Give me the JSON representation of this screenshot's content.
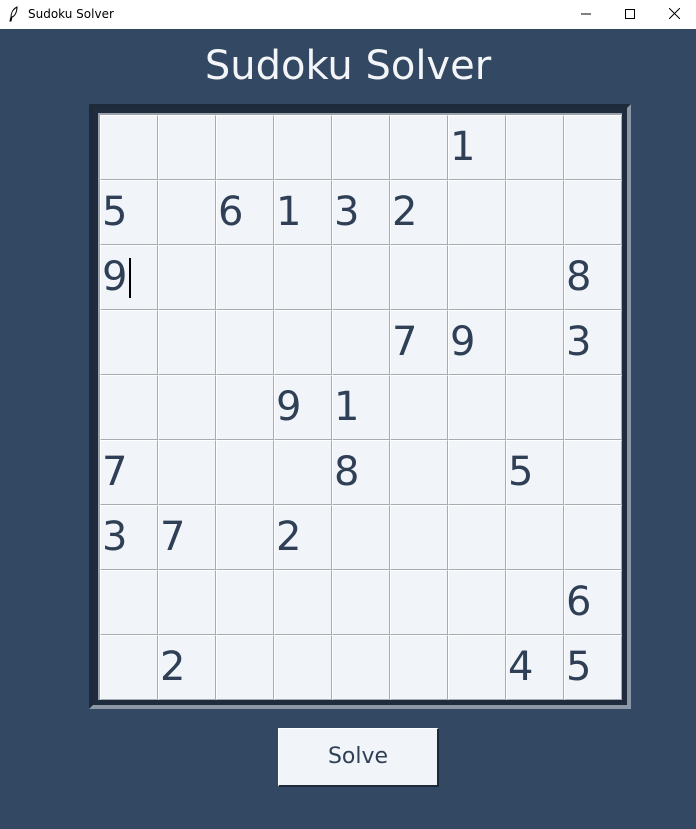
{
  "window": {
    "title": "Sudoku Solver",
    "icon": "feather-icon",
    "controls": [
      "minimize-icon",
      "maximize-icon",
      "close-icon"
    ]
  },
  "heading": "Sudoku Solver",
  "grid": [
    [
      "",
      "",
      "",
      "",
      "",
      "",
      "1",
      "",
      ""
    ],
    [
      "5",
      "",
      "6",
      "1",
      "3",
      "2",
      "",
      "",
      ""
    ],
    [
      "9",
      "",
      "",
      "",
      "",
      "",
      "",
      "",
      "8"
    ],
    [
      "",
      "",
      "",
      "",
      "",
      "7",
      "9",
      "",
      "3"
    ],
    [
      "",
      "",
      "",
      "9",
      "1",
      "",
      "",
      "",
      ""
    ],
    [
      "7",
      "",
      "",
      "",
      "8",
      "",
      "",
      "5",
      ""
    ],
    [
      "3",
      "7",
      "",
      "2",
      "",
      "",
      "",
      "",
      ""
    ],
    [
      "",
      "",
      "",
      "",
      "",
      "",
      "",
      "",
      "6"
    ],
    [
      "",
      "2",
      "",
      "",
      "",
      "",
      "",
      "4",
      "5"
    ]
  ],
  "focused_cell": {
    "row": 2,
    "col": 0
  },
  "solve_button": "Solve",
  "colors": {
    "background": "#334862",
    "cell": "#f1f4f8",
    "digit": "#2e3f56",
    "heading": "#f3f5f8"
  }
}
